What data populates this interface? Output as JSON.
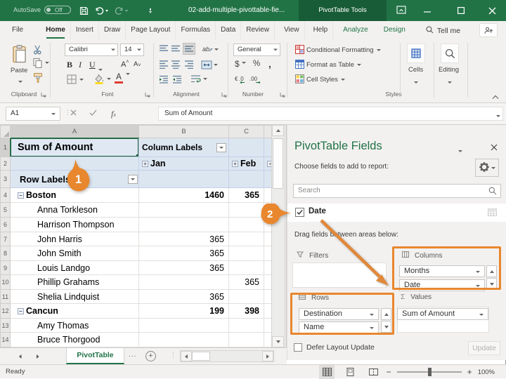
{
  "titlebar": {
    "autosave_label": "AutoSave",
    "autosave_state": "Off",
    "document_title": "02-add-multiple-pivottable-fie...",
    "contextual_tab": "PivotTable Tools"
  },
  "menubar": {
    "tabs": [
      "File",
      "Home",
      "Insert",
      "Draw",
      "Page Layout",
      "Formulas",
      "Data",
      "Review",
      "View",
      "Help",
      "Analyze",
      "Design"
    ],
    "tellme_label": "Tell me"
  },
  "ribbon": {
    "clipboard": {
      "label": "Clipboard",
      "paste_label": "Paste"
    },
    "font": {
      "label": "Font",
      "font_name": "Calibri",
      "font_size": "14"
    },
    "alignment": {
      "label": "Alignment"
    },
    "number": {
      "label": "Number",
      "format": "General"
    },
    "styles": {
      "label": "Styles",
      "conditional": "Conditional Formatting",
      "format_table": "Format as Table",
      "cell_styles": "Cell Styles"
    },
    "cells": {
      "label": "Cells"
    },
    "editing": {
      "label": "Editing"
    }
  },
  "formula_bar": {
    "name_box": "A1",
    "formula": "Sum of Amount"
  },
  "grid": {
    "col_headers": [
      "A",
      "B",
      "C"
    ],
    "rows": [
      {
        "n": "1",
        "a": "Sum of Amount",
        "b": "Column Labels",
        "c": ""
      },
      {
        "n": "2",
        "a": "",
        "b": "Jan",
        "c": "Feb"
      },
      {
        "n": "3",
        "a": "Row Labels",
        "b": "",
        "c": ""
      },
      {
        "n": "4",
        "a": "Boston",
        "b": "1460",
        "c": "365"
      },
      {
        "n": "5",
        "a": "Anna Torkleson",
        "b": "",
        "c": ""
      },
      {
        "n": "6",
        "a": "Harrison Thompson",
        "b": "",
        "c": ""
      },
      {
        "n": "7",
        "a": "John Harris",
        "b": "365",
        "c": ""
      },
      {
        "n": "8",
        "a": "John Smith",
        "b": "365",
        "c": ""
      },
      {
        "n": "9",
        "a": "Louis Landgo",
        "b": "365",
        "c": ""
      },
      {
        "n": "10",
        "a": "Phillip Grahams",
        "b": "",
        "c": "365"
      },
      {
        "n": "11",
        "a": "Shelia Lindquist",
        "b": "365",
        "c": ""
      },
      {
        "n": "12",
        "a": "Cancun",
        "b": "199",
        "c": "398"
      },
      {
        "n": "13",
        "a": "Amy Thomas",
        "b": "",
        "c": ""
      },
      {
        "n": "14",
        "a": "Bruce Thorgood",
        "b": "",
        "c": ""
      }
    ]
  },
  "pane": {
    "title": "PivotTable Fields",
    "choose_label": "Choose fields to add to report:",
    "search_placeholder": "Search",
    "field_date": "Date",
    "drag_label": "Drag fields between areas below:",
    "areas": {
      "filters": {
        "label": "Filters"
      },
      "columns": {
        "label": "Columns",
        "items": [
          "Months",
          "Date"
        ]
      },
      "rows": {
        "label": "Rows",
        "items": [
          "Destination",
          "Name"
        ]
      },
      "values": {
        "label": "Values",
        "items": [
          "Sum of Amount"
        ]
      }
    },
    "defer_label": "Defer Layout Update",
    "update_label": "Update"
  },
  "sheet_tabs": {
    "active": "PivotTable",
    "more": "..."
  },
  "status_bar": {
    "mode": "Ready",
    "zoom": "100%"
  },
  "callouts": {
    "step1": "1",
    "step2": "2"
  }
}
